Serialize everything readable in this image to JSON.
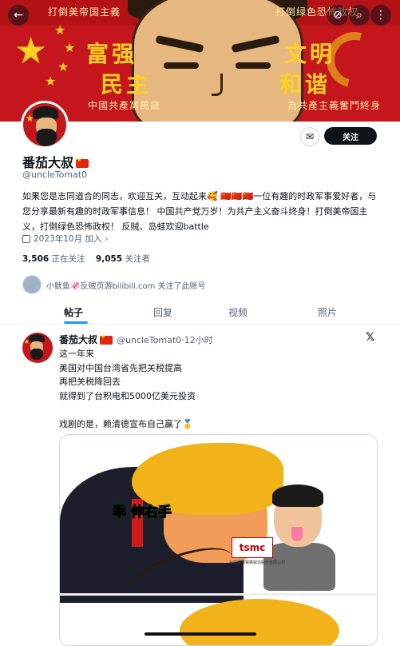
{
  "banner": {
    "top_left_text": "打倒美帝国主義",
    "top_right_text": "打倒绿色恐怖政权",
    "slogan_1": "富强",
    "slogan_2": "文明",
    "slogan_3": "民主",
    "slogan_4": "和谐",
    "bottom_left_text": "中國共產黨萬歲",
    "bottom_right_text": "為共產主義奮鬥終身"
  },
  "profile": {
    "display_name": "番茄大叔",
    "handle": "@uncleTomat0",
    "follow_label": "关注",
    "bio": "如果您是志同道合的同志，欢迎互关，互动起来🥰 🇨🇳🇨🇳🇨🇳一位有趣的时政军事爱好者，与您分享最新有趣的时政军事信息！ 中国共产党万岁！为共产主义奋斗终身！打倒美帝国主义，打倒绿色恐怖政权！ 反贼、岛蛙欢迎battle",
    "joined": "2023年10月 加入",
    "following_count": "3,506",
    "following_label": "正在关注",
    "followers_count": "9,055",
    "followers_label": "关注者",
    "followed_by": "小鱿鱼🦑反贼页游bilibili.com 关注了此账号"
  },
  "tabs": [
    "帖子",
    "回复",
    "视频",
    "照片"
  ],
  "post": {
    "name": "番茄大叔",
    "handle_time": "@uncleTomat0·12小时",
    "lines": [
      "这一年来",
      "美国对中国台湾省先把关税提高",
      "再把关税降回去",
      "就得到了台积电和5000亿美元投资",
      "",
      "戏剧的是，赖清德宣布自己赢了🥇"
    ],
    "image_caption": "乖 伸右手",
    "image_logo": "tsmc",
    "image_logo_sub": "台灣積體電路製造股份有限公司"
  },
  "colors": {
    "banner_red": "#c4161c",
    "slogan_gold": "#ffd21f",
    "accent_blue": "#1d9bf0"
  }
}
